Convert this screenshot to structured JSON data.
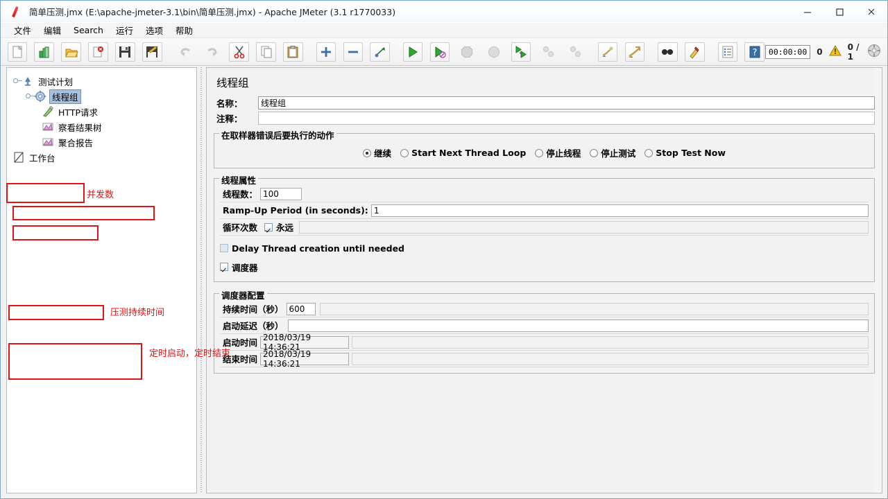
{
  "window": {
    "title": "简单压测.jmx (E:\\apache-jmeter-3.1\\bin\\简单压测.jmx) - Apache JMeter (3.1 r1770033)",
    "app_icon": "jmeter-feather-icon",
    "minimize_label": "—",
    "maximize_label": "□",
    "close_label": "✕"
  },
  "menubar": {
    "items": [
      {
        "label": "文件",
        "name": "menu-file"
      },
      {
        "label": "编辑",
        "name": "menu-edit"
      },
      {
        "label": "Search",
        "name": "menu-search"
      },
      {
        "label": "运行",
        "name": "menu-run"
      },
      {
        "label": "选项",
        "name": "menu-options"
      },
      {
        "label": "帮助",
        "name": "menu-help"
      }
    ]
  },
  "toolbar": {
    "buttons": [
      {
        "name": "new-icon",
        "title": "New"
      },
      {
        "name": "templates-icon",
        "title": "Templates"
      },
      {
        "name": "open-icon",
        "title": "Open"
      },
      {
        "name": "close-icon",
        "title": "Close"
      },
      {
        "name": "save-icon",
        "title": "Save"
      },
      {
        "name": "save-as-icon",
        "title": "Save As"
      },
      {
        "name": "undo-icon",
        "title": "Undo"
      },
      {
        "name": "redo-icon",
        "title": "Redo"
      },
      {
        "name": "cut-icon",
        "title": "Cut"
      },
      {
        "name": "copy-icon",
        "title": "Copy"
      },
      {
        "name": "paste-icon",
        "title": "Paste"
      },
      {
        "name": "expand-icon",
        "title": "Expand All"
      },
      {
        "name": "collapse-icon",
        "title": "Collapse All"
      },
      {
        "name": "toggle-icon",
        "title": "Toggle"
      },
      {
        "name": "start-icon",
        "title": "Start"
      },
      {
        "name": "start-no-pauses-icon",
        "title": "Start no pauses"
      },
      {
        "name": "stop-icon",
        "title": "Stop"
      },
      {
        "name": "shutdown-icon",
        "title": "Shutdown"
      },
      {
        "name": "remote-start-all-icon",
        "title": "Remote Start All"
      },
      {
        "name": "remote-stop-all-icon",
        "title": "Remote Stop All"
      },
      {
        "name": "remote-shutdown-all-icon",
        "title": "Remote Shutdown All"
      },
      {
        "name": "clear-icon",
        "title": "Clear"
      },
      {
        "name": "clear-all-icon",
        "title": "Clear All"
      },
      {
        "name": "search-icon",
        "title": "Search"
      },
      {
        "name": "search-reset-icon",
        "title": "Reset Search"
      },
      {
        "name": "function-helper-icon",
        "title": "Function Helper Dialog"
      },
      {
        "name": "help-icon",
        "title": "Help"
      }
    ],
    "status": {
      "timer": "00:00:00",
      "warning_count": "0",
      "warning_icon": "warning-triangle-icon",
      "threads": "0 / 1",
      "activity_icon": "thread-activity-icon"
    }
  },
  "tree": {
    "nodes": [
      {
        "label": "测试计划",
        "icon": "test-plan-icon",
        "indent": 1,
        "selected": false,
        "name": "tree-node-test-plan"
      },
      {
        "label": "线程组",
        "icon": "thread-group-icon",
        "indent": 2,
        "selected": true,
        "name": "tree-node-thread-group"
      },
      {
        "label": "HTTP请求",
        "icon": "http-request-icon",
        "indent": 3,
        "selected": false,
        "name": "tree-node-http-request"
      },
      {
        "label": "察看结果树",
        "icon": "view-results-tree-icon",
        "indent": 3,
        "selected": false,
        "name": "tree-node-view-results-tree"
      },
      {
        "label": "聚合报告",
        "icon": "aggregate-report-icon",
        "indent": 3,
        "selected": false,
        "name": "tree-node-aggregate-report"
      },
      {
        "label": "工作台",
        "icon": "workbench-icon",
        "indent": 1,
        "selected": false,
        "name": "tree-node-workbench"
      }
    ]
  },
  "main": {
    "title": "线程组",
    "name_label": "名称：",
    "name_value": "线程组",
    "comment_label": "注释：",
    "comment_value": "",
    "error_action": {
      "legend": "在取样器错误后要执行的动作",
      "options": [
        {
          "label": "继续",
          "selected": true
        },
        {
          "label": "Start Next Thread Loop",
          "selected": false
        },
        {
          "label": "停止线程",
          "selected": false
        },
        {
          "label": "停止测试",
          "selected": false
        },
        {
          "label": "Stop Test Now",
          "selected": false
        }
      ]
    },
    "thread_properties": {
      "legend": "线程属性",
      "threads_label": "线程数：",
      "threads_value": "100",
      "rampup_label": "Ramp-Up Period (in seconds):",
      "rampup_value": "1",
      "loop_label": "循环次数",
      "forever_label": "永远",
      "forever_checked": true,
      "loop_value": "",
      "delay_creation_label": "Delay Thread creation until needed",
      "delay_creation_checked": false,
      "scheduler_label": "调度器",
      "scheduler_checked": true
    },
    "scheduler_config": {
      "legend": "调度器配置",
      "duration_label": "持续时间（秒）",
      "duration_value": "600",
      "startup_delay_label": "启动延迟（秒）",
      "startup_delay_value": "",
      "start_time_label": "启动时间",
      "start_time_value": "2018/03/19 14:36:21",
      "end_time_label": "结束时间",
      "end_time_value": "2018/03/19 14:36:21"
    }
  },
  "annotations": {
    "color": "#e01414",
    "notes": [
      {
        "text": "并发数",
        "name": "annotation-concurrency"
      },
      {
        "text": "压测持续时间",
        "name": "annotation-duration"
      },
      {
        "text": "定时启动，定时结束",
        "name": "annotation-schedule"
      }
    ]
  }
}
